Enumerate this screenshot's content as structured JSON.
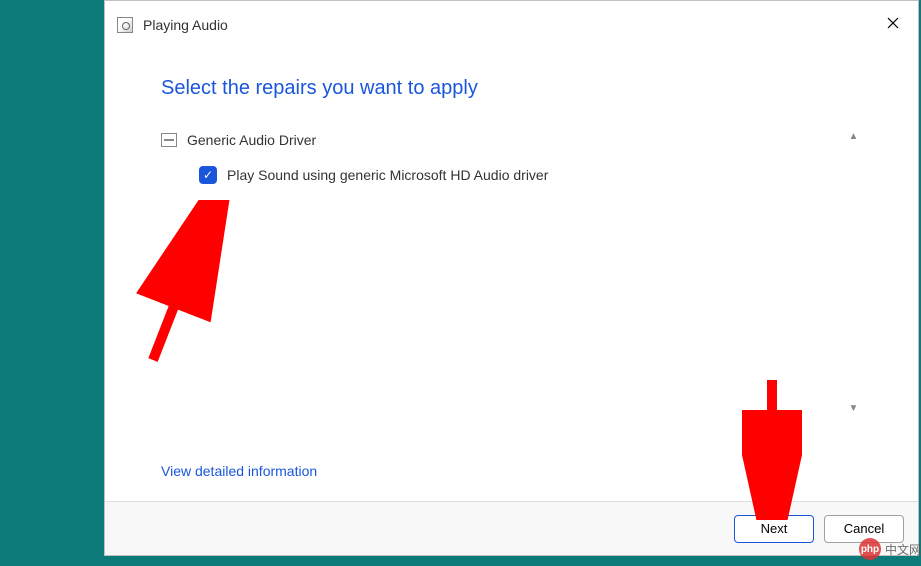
{
  "window": {
    "title": "Playing Audio"
  },
  "heading": "Select the repairs you want to apply",
  "group": {
    "label": "Generic Audio Driver"
  },
  "repair": {
    "checked": true,
    "label": "Play Sound using generic Microsoft HD Audio driver"
  },
  "link": {
    "detailed": "View detailed information"
  },
  "buttons": {
    "next": "Next",
    "cancel": "Cancel"
  },
  "watermark": {
    "logo": "php",
    "text": "中文网"
  }
}
